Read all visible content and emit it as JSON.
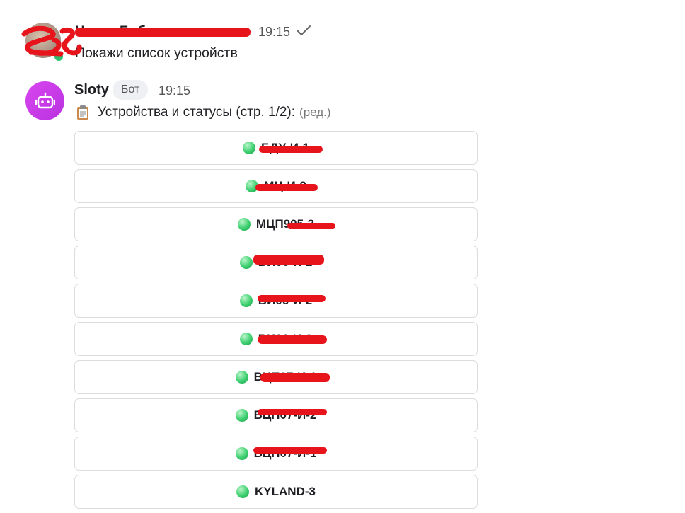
{
  "user_message": {
    "author": "Никия Бобш",
    "time": "19:15",
    "status_icon": "check-icon",
    "text": "Покажи список устройств"
  },
  "bot_message": {
    "author": "Sloty",
    "badge": "Бот",
    "time": "19:15",
    "header_icon": "clipboard-icon",
    "header_text": "Устройства и статусы (стр. 1/2):",
    "edited_label": "(ред.)"
  },
  "devices": [
    {
      "label": "БДУ-И-1",
      "status_color": "#3ccf6f"
    },
    {
      "label": "МЦ-И-2",
      "status_color": "#3ccf6f"
    },
    {
      "label": "МЦП905-3",
      "status_color": "#3ccf6f"
    },
    {
      "label": "ВИ06-И-1",
      "status_color": "#3ccf6f"
    },
    {
      "label": "ВИ06-И-2",
      "status_color": "#3ccf6f"
    },
    {
      "label": "ВИ06-И-3",
      "status_color": "#3ccf6f"
    },
    {
      "label": "ВЦП07-И-1",
      "status_color": "#3ccf6f"
    },
    {
      "label": "ВЦП07-И-2",
      "status_color": "#3ccf6f"
    },
    {
      "label": "ВЦП07-И-1",
      "status_color": "#3ccf6f"
    },
    {
      "label": "KYLAND-3",
      "status_color": "#3ccf6f"
    }
  ],
  "colors": {
    "bot_avatar": "#c93ee8",
    "online": "#2fbf71",
    "redaction": "#e8141c"
  }
}
